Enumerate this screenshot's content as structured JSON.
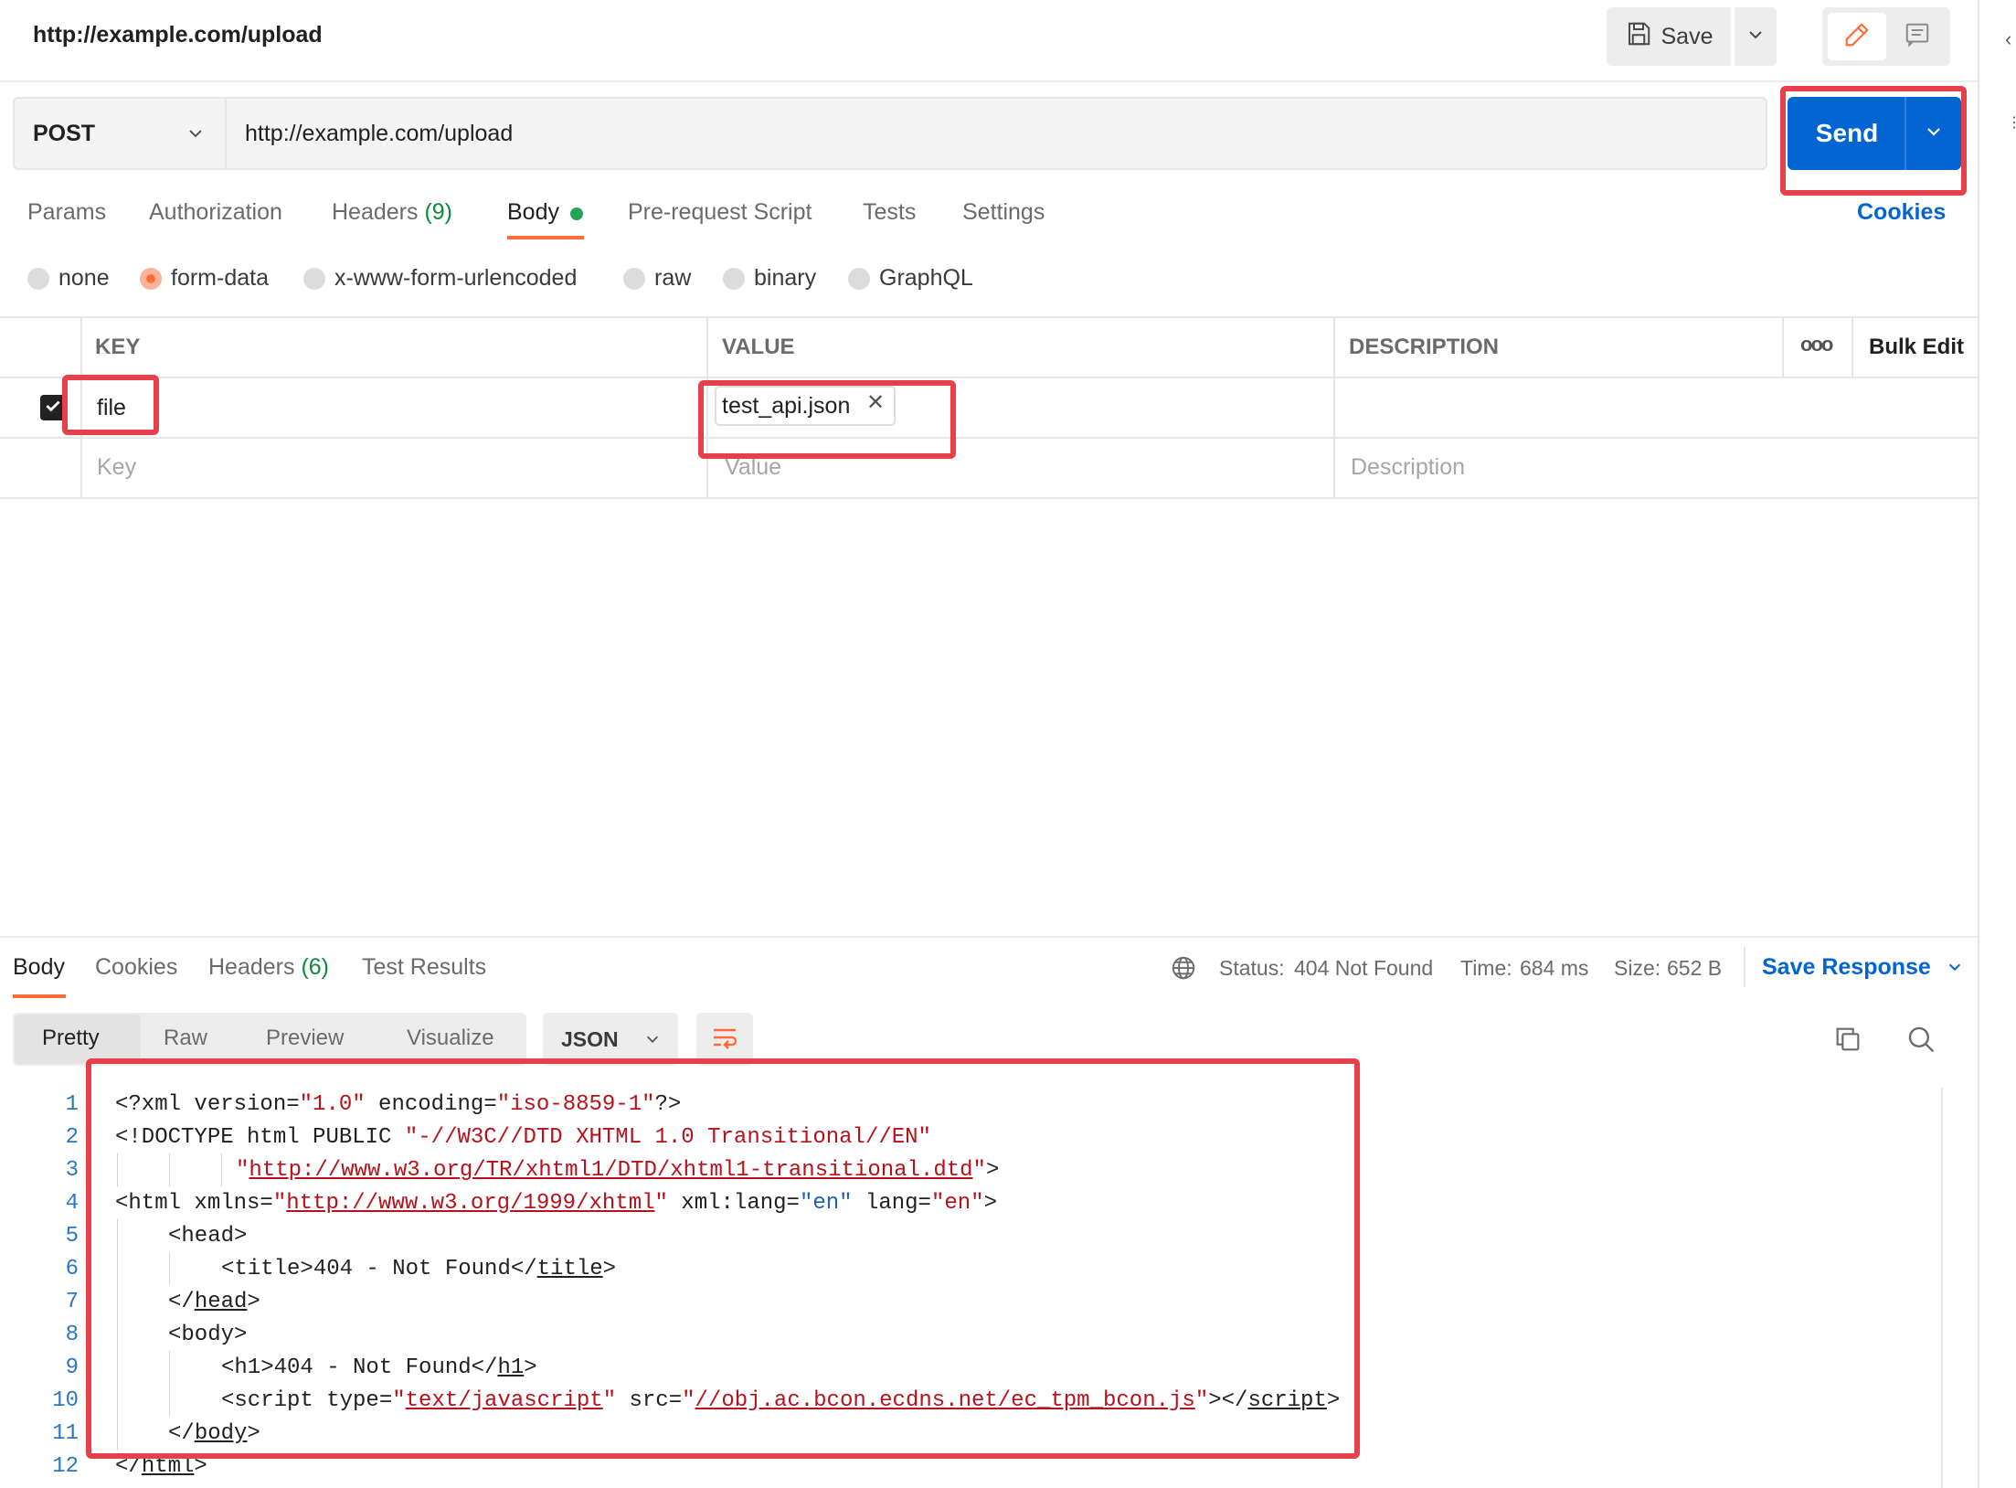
{
  "header": {
    "title": "http://example.com/upload",
    "save_label": "Save"
  },
  "request": {
    "method": "POST",
    "url": "http://example.com/upload",
    "send_label": "Send",
    "cookies_label": "Cookies"
  },
  "tabs": [
    {
      "label": "Params"
    },
    {
      "label": "Authorization"
    },
    {
      "label": "Headers",
      "count": "(9)"
    },
    {
      "label": "Body"
    },
    {
      "label": "Pre-request Script"
    },
    {
      "label": "Tests"
    },
    {
      "label": "Settings"
    }
  ],
  "body_types": [
    {
      "label": "none",
      "selected": false
    },
    {
      "label": "form-data",
      "selected": true
    },
    {
      "label": "x-www-form-urlencoded",
      "selected": false
    },
    {
      "label": "raw",
      "selected": false
    },
    {
      "label": "binary",
      "selected": false
    },
    {
      "label": "GraphQL",
      "selected": false
    }
  ],
  "table": {
    "columns": [
      "KEY",
      "VALUE",
      "DESCRIPTION"
    ],
    "more_icon": "ooo",
    "bulk_edit_label": "Bulk Edit",
    "rows": [
      {
        "checked": true,
        "key": "file",
        "value_file": "test_api.json",
        "description": ""
      }
    ],
    "placeholders": {
      "key": "Key",
      "value": "Value",
      "description": "Description"
    }
  },
  "response": {
    "tabs": [
      {
        "label": "Body"
      },
      {
        "label": "Cookies"
      },
      {
        "label": "Headers",
        "count": "(6)"
      },
      {
        "label": "Test Results"
      }
    ],
    "status_label": "Status:",
    "status_value": "404 Not Found",
    "time_label": "Time:",
    "time_value": "684 ms",
    "size_label": "Size:",
    "size_value": "652 B",
    "save_response_label": "Save Response",
    "views": [
      "Pretty",
      "Raw",
      "Preview",
      "Visualize"
    ],
    "format": "JSON",
    "line_numbers": [
      "1",
      "2",
      "3",
      "4",
      "5",
      "6",
      "7",
      "8",
      "9",
      "10",
      "11",
      "12"
    ],
    "code": {
      "l1": {
        "a": "<?xml version=",
        "s1": "\"1.0\"",
        "b": " encoding=",
        "s2": "\"iso-8859-1\"",
        "c": "?>"
      },
      "l2": {
        "a": "<!DOCTYPE html PUBLIC ",
        "s": "\"-//W3C//DTD XHTML 1.0 Transitional//EN\""
      },
      "l3": {
        "q1": "\"",
        "url": "http://www.w3.org/TR/xhtml1/DTD/xhtml1-transitional.dtd",
        "q2": "\"",
        "c": ">"
      },
      "l4": {
        "a": "<html xmlns=",
        "q1": "\"",
        "url": "http://www.w3.org/1999/xhtml",
        "q2": "\"",
        "b": " xml:lang=",
        "s1": "\"en\"",
        "c": " lang=",
        "s2": "\"en\"",
        "d": ">"
      },
      "l5": "<head>",
      "l6": {
        "a": "<title>404 - Not Found</",
        "tag": "title",
        "b": ">"
      },
      "l7": {
        "a": "</",
        "tag": "head",
        "b": ">"
      },
      "l8": "<body>",
      "l9": {
        "a": "<h1>404 - Not Found</",
        "tag": "h1",
        "b": ">"
      },
      "l10": {
        "a": "<script type=",
        "q1": "\"",
        "s": "text/javascript",
        "q2": "\"",
        "b": " src=",
        "q3": "\"",
        "url": "//obj.ac.bcon.ecdns.net/ec_tpm_bcon.js",
        "q4": "\"",
        "c": "></",
        "tag": "script",
        "d": ">"
      },
      "l11": {
        "a": "</",
        "tag": "body",
        "b": ">"
      },
      "l12": {
        "a": "</",
        "tag": "html",
        "b": ">"
      }
    }
  },
  "colors": {
    "accent_orange": "#ff6c37",
    "send_blue": "#0265d2",
    "highlight_red": "#e6404a",
    "status_green": "#0f8a3a",
    "code_string": "#b5121b",
    "line_number": "#2a78c2"
  },
  "icons": {
    "save": "save-icon",
    "chevron": "chevron-down-icon",
    "edit": "pencil-icon",
    "comment": "comment-icon",
    "globe": "globe-icon",
    "copy": "copy-icon",
    "search": "search-icon",
    "wrap": "wrap-lines-icon",
    "remove": "close-icon",
    "check": "check-icon"
  }
}
